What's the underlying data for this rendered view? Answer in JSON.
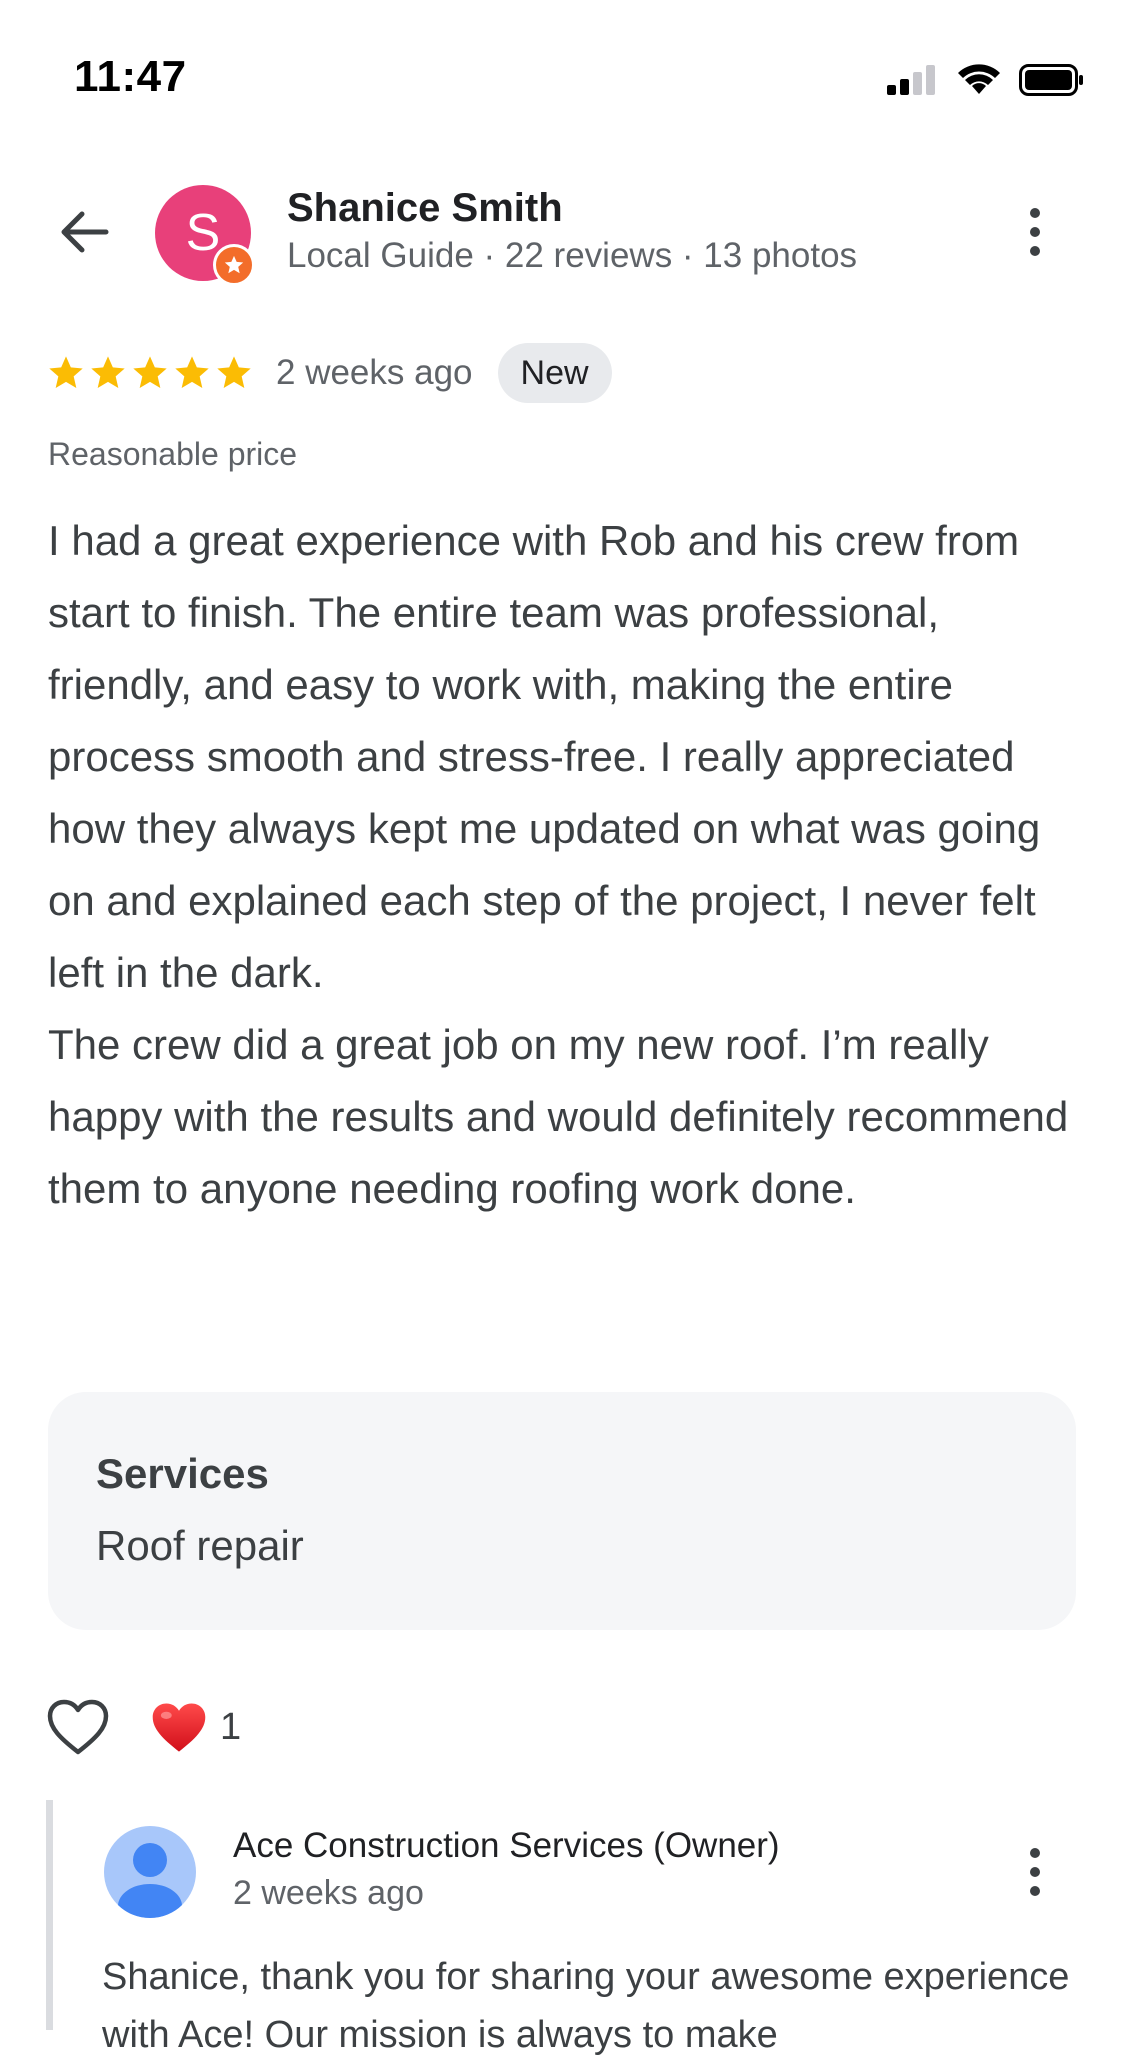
{
  "status_bar": {
    "time": "11:47",
    "icons": [
      "cellular-signal-icon",
      "wifi-icon",
      "battery-icon"
    ]
  },
  "header": {
    "back_icon": "arrow-left-icon",
    "avatar_letter": "S",
    "avatar_color": "#e8407a",
    "badge_icon": "local-guide-star-icon",
    "name": "Shanice Smith",
    "meta": "Local Guide · 22 reviews · 13 photos",
    "more_icon": "more-vertical-icon"
  },
  "review": {
    "rating": 5,
    "rating_max": 5,
    "star_color": "#fbbc04",
    "time_ago": "2 weeks ago",
    "badge": "New",
    "price_label": "Reasonable price",
    "paragraphs": [
      "I had a great experience with Rob and his crew from start to finish. The entire team was professional, friendly, and easy to work with, making the entire process smooth and stress-free. I really appreciated how they always kept me updated on what was going on and explained each step of the project, I never felt left in the dark.",
      "The crew did a great job on my new roof. I’m really happy with the results and would definitely recommend them to anyone needing roofing work done."
    ],
    "services_title": "Services",
    "services_value": "Roof repair"
  },
  "reactions": {
    "like_icon": "heart-outline-icon",
    "reaction_icon": "red-heart-icon",
    "count": "1"
  },
  "owner_reply": {
    "name": "Ace Construction Services (Owner)",
    "time_ago": "2 weeks ago",
    "avatar_icon": "default-person-avatar-icon",
    "more_icon": "more-vertical-icon",
    "text": "Shanice, thank you for sharing your awesome experience with Ace! Our mission is always to make"
  }
}
